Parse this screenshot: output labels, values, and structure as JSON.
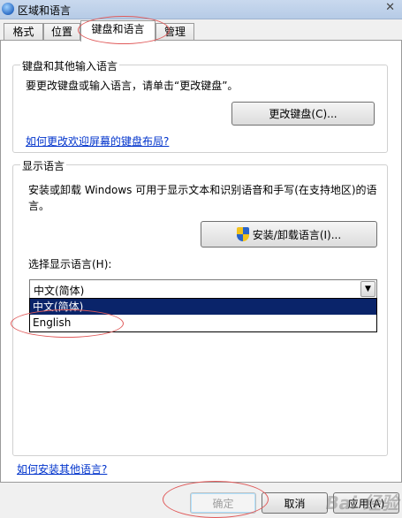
{
  "window": {
    "title": "区域和语言"
  },
  "tabs": [
    "格式",
    "位置",
    "键盘和语言",
    "管理"
  ],
  "keyboard_group": {
    "legend": "键盘和其他输入语言",
    "instruction": "要更改键盘或输入语言，请单击“更改键盘”。",
    "change_button": "更改键盘(C)...",
    "welcome_link": "如何更改欢迎屏幕的键盘布局?"
  },
  "display_group": {
    "legend": "显示语言",
    "description_line1": "安装或卸载 Windows 可用于显示文本和识别语音和手写(在支持地区)的语",
    "description_line2": "言。",
    "install_button": "安装/卸载语言(I)...",
    "choose_label": "选择显示语言(H):",
    "selected_value": "中文(简体)",
    "options": [
      "中文(简体)",
      "English"
    ]
  },
  "footer": {
    "other_languages_link": "如何安装其他语言?",
    "ok_button": "确定",
    "cancel_button": "取消",
    "apply_button": "应用(A)"
  },
  "watermark": "Bai 经验"
}
